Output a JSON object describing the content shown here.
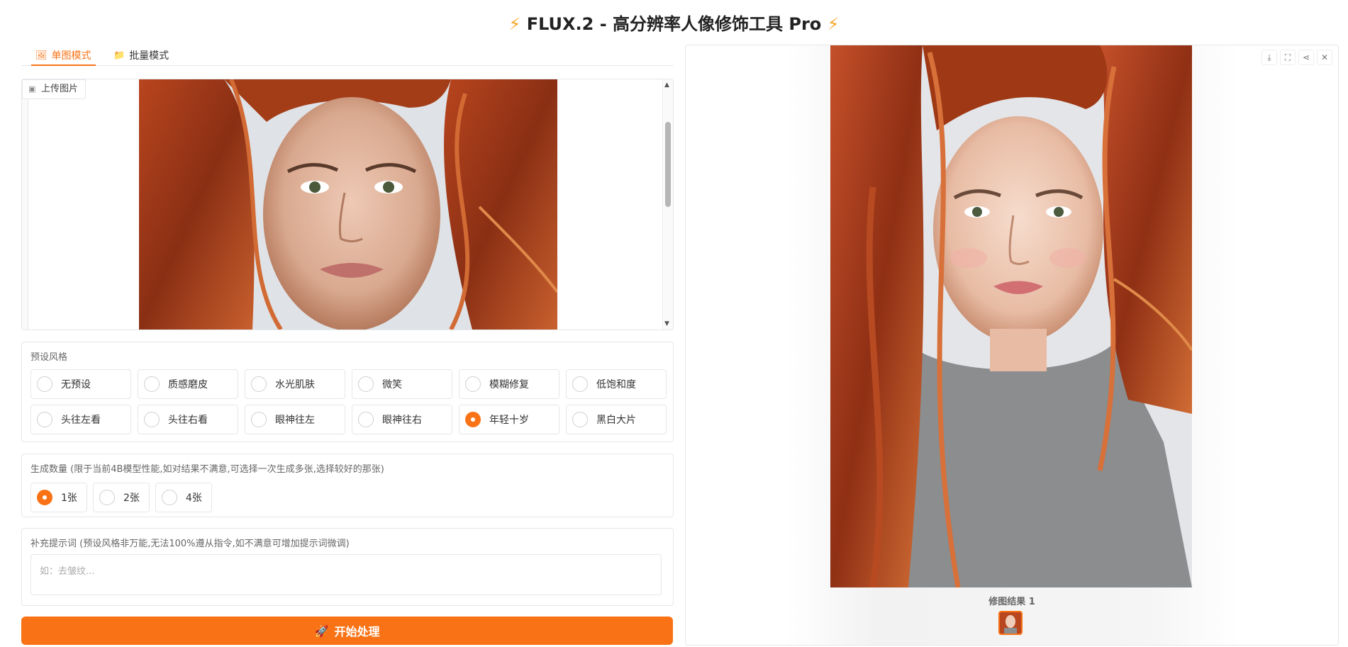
{
  "header": {
    "title": "FLUX.2 - 高分辨率人像修饰工具 Pro",
    "icon": "lightning-icon"
  },
  "tabs": [
    {
      "label": "单图模式",
      "icon": "image-icon",
      "active": true
    },
    {
      "label": "批量模式",
      "icon": "folder-icon",
      "active": false
    }
  ],
  "upload": {
    "label": "上传图片"
  },
  "presets": {
    "label": "预设风格",
    "options": [
      "无预设",
      "质感磨皮",
      "水光肌肤",
      "微笑",
      "模糊修复",
      "低饱和度",
      "头往左看",
      "头往右看",
      "眼神往左",
      "眼神往右",
      "年轻十岁",
      "黑白大片"
    ],
    "selected": "年轻十岁"
  },
  "count": {
    "label": "生成数量 (限于当前4B模型性能,如对结果不满意,可选择一次生成多张,选择较好的那张)",
    "options": [
      "1张",
      "2张",
      "4张"
    ],
    "selected": "1张"
  },
  "prompt": {
    "label": "补充提示词 (预设风格非万能,无法100%遵从指令,如不满意可增加提示词微调)",
    "placeholder": "如：去皱纹...",
    "value": ""
  },
  "start_button": {
    "label": "开始处理",
    "icon": "rocket-icon"
  },
  "result": {
    "caption": "修图结果 1",
    "toolbar_icons": [
      "download-icon",
      "fullscreen-icon",
      "share-icon",
      "close-icon"
    ]
  },
  "colors": {
    "accent": "#f97316",
    "bolt": "#f5a623"
  }
}
